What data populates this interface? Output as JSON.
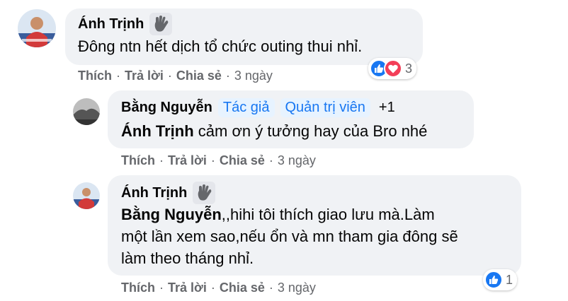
{
  "comments": [
    {
      "author": "Ánh Trịnh",
      "text": "Đông ntn hết dịch tổ chức outing thui nhỉ.",
      "actions": [
        "Thích",
        "Trả lời",
        "Chia sẻ"
      ],
      "time": "3 ngày",
      "reaction_count": "3",
      "reaction_icons": [
        "like-icon",
        "love-icon"
      ]
    },
    {
      "author": "Bằng Nguyễn",
      "badges": [
        "Tác giả",
        "Quản trị viên"
      ],
      "badge_more": "+1",
      "mention": "Ánh Trịnh",
      "text": " cảm ơn ý tưởng hay của Bro nhé",
      "actions": [
        "Thích",
        "Trả lời",
        "Chia sẻ"
      ],
      "time": "3 ngày"
    },
    {
      "author": "Ánh Trịnh",
      "mention": "Bằng Nguyễn",
      "text_lines": [
        ",,hihi tôi thích giao lưu mà.Làm",
        "một lần xem sao,nếu ổn và mn tham gia đông sẽ",
        "làm theo tháng nhỉ."
      ],
      "actions": [
        "Thích",
        "Trả lời",
        "Chia sẻ"
      ],
      "time": "3 ngày",
      "reaction_count": "1",
      "reaction_icons": [
        "like-icon"
      ]
    }
  ],
  "colors": {
    "bubble": "#f0f2f5",
    "badge_bg": "#e7f3ff",
    "badge_text": "#1877f2",
    "meta_text": "#65676b",
    "like": "#1877f2",
    "love": "#f33e58"
  }
}
